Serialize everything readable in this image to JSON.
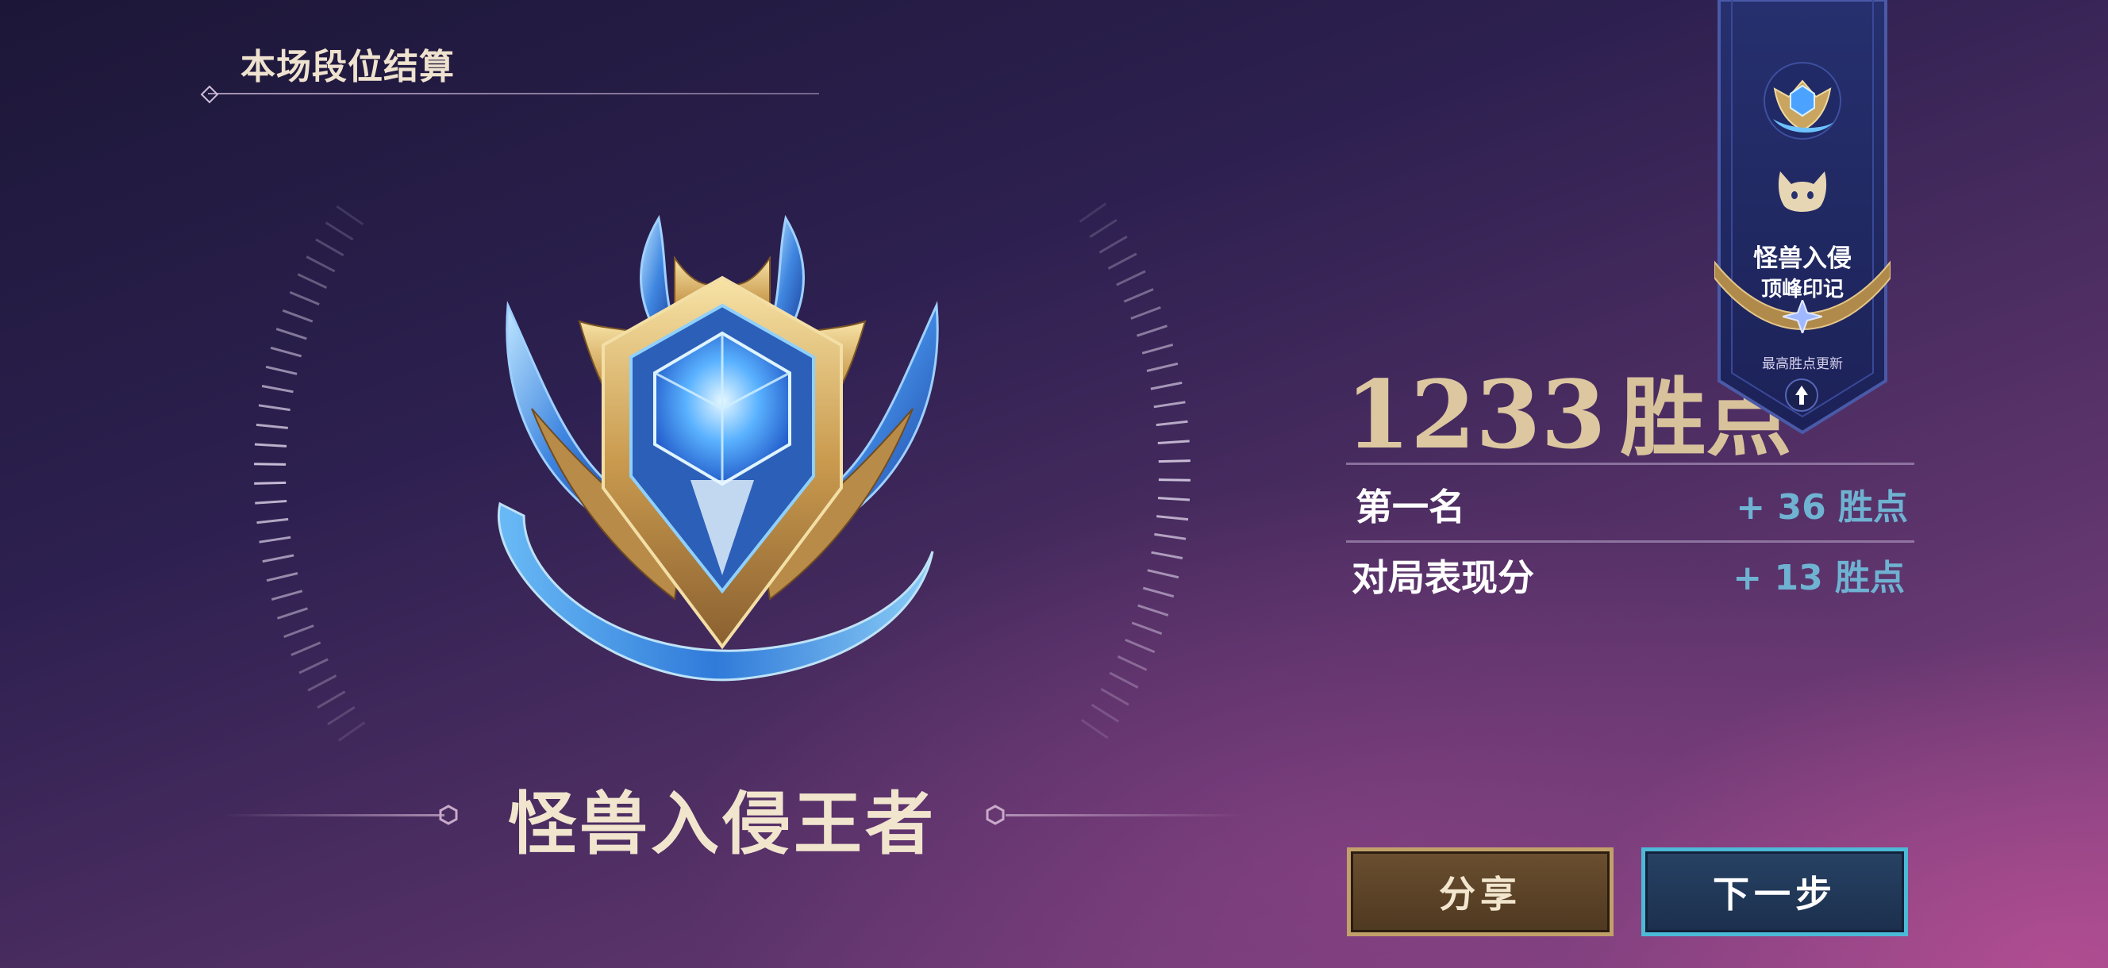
{
  "header": {
    "title": "本场段位结算"
  },
  "rank": {
    "name": "怪兽入侵王者"
  },
  "points": {
    "value": "1233",
    "unit": "胜点"
  },
  "breakdown": [
    {
      "label": "第一名",
      "value": "+ 36 胜点"
    },
    {
      "label": "对局表现分",
      "value": "+ 13 胜点"
    }
  ],
  "buttons": {
    "share": "分享",
    "next": "下一步"
  },
  "banner": {
    "title": "怪兽入侵",
    "subtitle": "顶峰印记",
    "update_text": "最高胜点更新"
  },
  "colors": {
    "gold": "#dcc7a0",
    "blue_value": "#6fb2d2",
    "share_border": "#c2a06a",
    "next_border": "#4cb9d6"
  },
  "icons": [
    "diamond-icon",
    "hex-icon",
    "rank-emblem-icon",
    "monster-icon",
    "up-arrow-icon",
    "star-icon"
  ]
}
